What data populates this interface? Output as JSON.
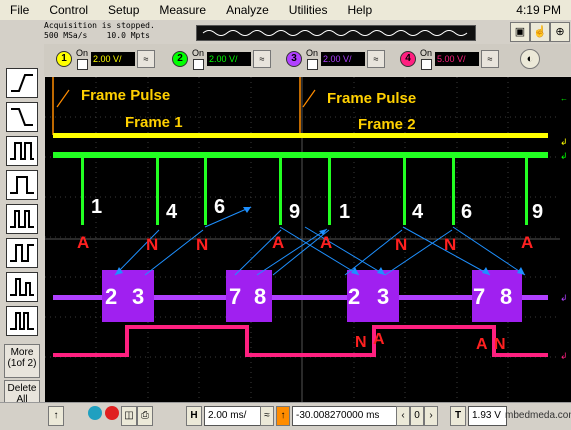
{
  "menu": {
    "items": [
      "File",
      "Control",
      "Setup",
      "Measure",
      "Analyze",
      "Utilities",
      "Help"
    ],
    "clock": "4:19 PM"
  },
  "status": {
    "line1": "Acquisition is stopped.",
    "line2": "500 MSa/s    10.0 Mpts"
  },
  "channels": [
    {
      "num": "1",
      "on": "On",
      "scale": "2.00 V/",
      "color": "#ffff00"
    },
    {
      "num": "2",
      "on": "On",
      "scale": "2.00 V/",
      "color": "#00ff00"
    },
    {
      "num": "3",
      "on": "On",
      "scale": "2.00 V/",
      "color": "#b040ff"
    },
    {
      "num": "4",
      "on": "On",
      "scale": "5.00 V/",
      "color": "#ff2080"
    }
  ],
  "side": {
    "more": "More\n(1of 2)",
    "delete": "Delete\nAll"
  },
  "bottom": {
    "h_label": "H",
    "timebase": "2.00 ms/",
    "delay": "-30.008270000 ms",
    "t_label": "T",
    "trig_level": "1.93 V",
    "watermark": "mbedmeda.com"
  },
  "annotations": {
    "frame_pulse_1": "Frame Pulse",
    "frame_pulse_2": "Frame Pulse",
    "frame1": "Frame 1",
    "frame2": "Frame 2",
    "numbers_green": [
      "1",
      "4",
      "6",
      "9",
      "1",
      "4",
      "6",
      "9"
    ],
    "letters_green": [
      "A",
      "N",
      "N",
      "A",
      "A",
      "N",
      "N",
      "A"
    ],
    "numbers_purple": [
      "2",
      "3",
      "7",
      "8",
      "2",
      "3",
      "7",
      "8"
    ],
    "letters_pink": [
      "N",
      "A",
      "A",
      "N"
    ]
  },
  "colors": {
    "ch1": "#ffff00",
    "ch2": "#00ff00",
    "ch3": "#b040ff",
    "ch4": "#ff2080",
    "arrow": "#1e90ff",
    "label_red": "#ff2020",
    "frame_pulse": "#ff8c00"
  }
}
